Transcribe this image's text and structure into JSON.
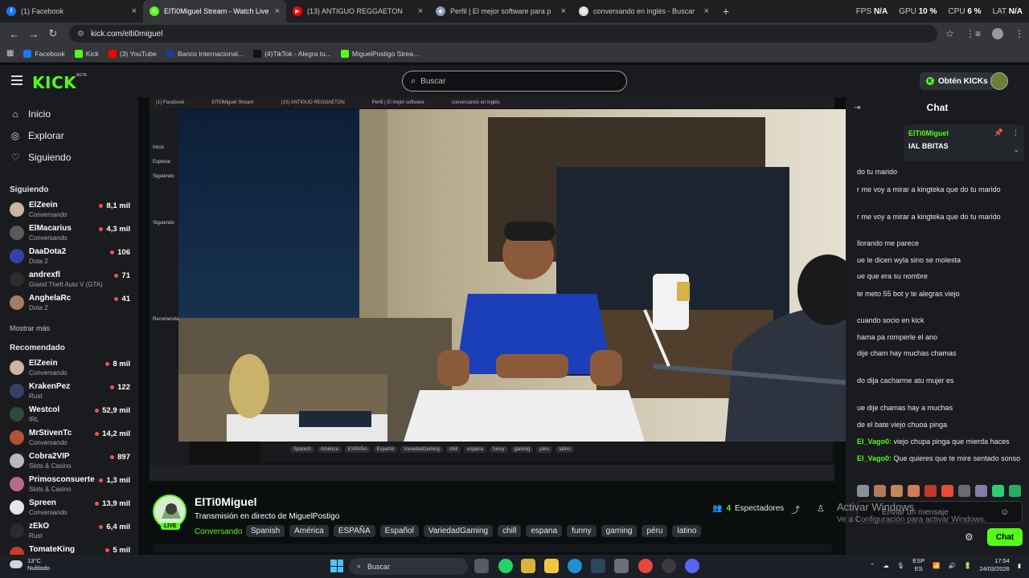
{
  "browser": {
    "tabs": [
      {
        "title": "(1) Facebook",
        "color": "#1877f2",
        "glyph": "f",
        "active": false
      },
      {
        "title": "ElTi0Miguel Stream - Watch Live",
        "color": "#53fc18",
        "glyph": "K",
        "active": true
      },
      {
        "title": "(13) ANTIGUO REGGAETON",
        "color": "#ff0000",
        "glyph": "▶",
        "active": false
      },
      {
        "title": "Perfil | El mejor software para p",
        "color": "#8f9bb3",
        "glyph": "◆",
        "active": false
      },
      {
        "title": "conversando en inglés - Buscar",
        "color": "#dddddd",
        "glyph": "G",
        "active": false
      }
    ],
    "stats": {
      "fps_label": "FPS",
      "fps": "N/A",
      "gpu_label": "GPU",
      "gpu": "10 %",
      "cpu_label": "CPU",
      "cpu": "6 %",
      "lat_label": "LAT",
      "lat": "N/A"
    },
    "url": "kick.com/elti0miguel",
    "bookmarks": [
      {
        "label": "Facebook",
        "color": "#1877f2"
      },
      {
        "label": "Kick",
        "color": "#53fc18"
      },
      {
        "label": "(3) YouTube",
        "color": "#ff0000"
      },
      {
        "label": "Banco Internacional...",
        "color": "#1f3c88"
      },
      {
        "label": "(4)TikTok - Alegra tu...",
        "color": "#111111"
      },
      {
        "label": "MiguelPostigo Strea...",
        "color": "#53fc18"
      }
    ]
  },
  "kick": {
    "logo": "KICK",
    "beta": "BETA",
    "search_placeholder": "Buscar",
    "get_kicks": "Obtén KICKs",
    "nav": [
      {
        "label": "Inicio",
        "icon": "home-icon"
      },
      {
        "label": "Explorar",
        "icon": "compass-icon"
      },
      {
        "label": "Siguiendo",
        "icon": "heart-icon"
      }
    ],
    "following_title": "Siguiendo",
    "following": [
      {
        "name": "ElZeein",
        "category": "Conversando",
        "viewers": "8,1 mil",
        "color": "#c9b7a3"
      },
      {
        "name": "ElMacarius",
        "category": "Conversando",
        "viewers": "4,3 mil",
        "color": "#5a5a5a"
      },
      {
        "name": "DaaDota2",
        "category": "Dota 2",
        "viewers": "106",
        "color": "#3a3fa8"
      },
      {
        "name": "andrexfl",
        "category": "Grand Theft Auto V (GTA)",
        "viewers": "71",
        "color": "#2d2d2d"
      },
      {
        "name": "AnghelaRc",
        "category": "Dota 2",
        "viewers": "41",
        "color": "#a67c63"
      }
    ],
    "show_more": "Mostrar más",
    "recommended_title": "Recomendado",
    "recommended": [
      {
        "name": "ElZeein",
        "category": "Conversando",
        "viewers": "8 mil",
        "color": "#c9b7a3"
      },
      {
        "name": "KrakenPez",
        "category": "Rust",
        "viewers": "122",
        "color": "#3a3f68"
      },
      {
        "name": "Westcol",
        "category": "IRL",
        "viewers": "52,9 mil",
        "color": "#2e4a3a"
      },
      {
        "name": "MrStivenTc",
        "category": "Conversando",
        "viewers": "14,2 mil",
        "color": "#b5532e"
      },
      {
        "name": "Cobra2VIP",
        "category": "Slots & Casino",
        "viewers": "897",
        "color": "#b9b9b9"
      },
      {
        "name": "Primosconsuerte",
        "category": "Slots & Casino",
        "viewers": "1,3 mil",
        "color": "#b66a8c"
      },
      {
        "name": "Spreen",
        "category": "Conversando",
        "viewers": "13,9 mil",
        "color": "#e6e6e6"
      },
      {
        "name": "zEkO",
        "category": "Rust",
        "viewers": "6,4 mil",
        "color": "#2b2b2b"
      },
      {
        "name": "TomateKing",
        "category": "",
        "viewers": "5 mil",
        "color": "#c93a2a"
      }
    ]
  },
  "stream": {
    "streamer": "ElTi0Miguel",
    "title": "Transmisión en directo de MiguelPostigo",
    "live": "LIVE",
    "category": "Conversando",
    "tags": [
      "Spanish",
      "América",
      "ESPAÑA",
      "Español",
      "VariedadGaming",
      "chill",
      "espana",
      "funny",
      "gaming",
      "péru",
      "latino"
    ],
    "viewers_count": "4",
    "viewers_label": "Espectadores"
  },
  "chat": {
    "title": "Chat",
    "pinned_user": "ElTi0Miguel",
    "pinned_text": "IAL BBITAS",
    "messages": [
      {
        "user": "",
        "text": "do tu marido"
      },
      {
        "user": "",
        "text": "r me voy a mirar a kingteka que do tu marido"
      },
      {
        "user": "",
        "text": "r me voy a mirar a kingteka que do tu marido"
      },
      {
        "user": "",
        "text": "llorando me parece"
      },
      {
        "user": "",
        "text": "ue le dicen wyla sino se molesta"
      },
      {
        "user": "",
        "text": "ue que era su nombre"
      },
      {
        "user": "",
        "text": "te meto 55 bot y te alegras viejo"
      },
      {
        "user": "",
        "text": "cuando socio en kick"
      },
      {
        "user": "",
        "text": "hama pa romperle el ano"
      },
      {
        "user": "",
        "text": "dije cham hay muchas chamas"
      },
      {
        "user": "",
        "text": "do dija cacharme atu mujer es"
      },
      {
        "user": "",
        "text": "ue dije chamas hay a muchas"
      },
      {
        "user": "",
        "text": "de el bate viejo chuoa pinga"
      },
      {
        "user": "El_Vago0:",
        "text": "viejo chupa pinga que mierda haces"
      },
      {
        "user": "El_Vago0:",
        "text": "Que quieres que te mire sentado sonso"
      }
    ],
    "input_placeholder": "Enviar un mensaje",
    "send_label": "Chat"
  },
  "windows_watermark": {
    "line1": "Activar Windows",
    "line2": "Ve a Configuración para activar Windows."
  },
  "taskbar": {
    "temp": "13°C",
    "weather": "Nublado",
    "search": "Buscar",
    "lang1": "ESP",
    "lang2": "ES",
    "time": "17:54",
    "date": "24/03/2026"
  }
}
